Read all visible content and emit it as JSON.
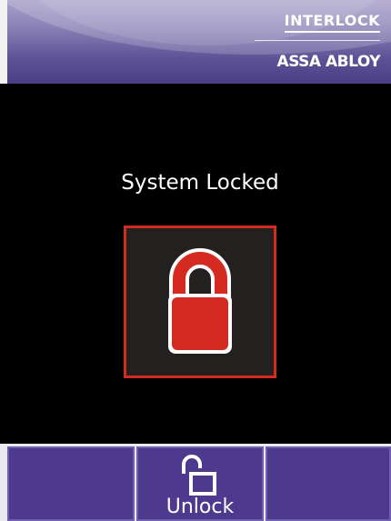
{
  "header": {
    "brand_primary": "INTERLOCK",
    "brand_secondary": "ASSA ABLOY"
  },
  "main": {
    "status_text": "System Locked",
    "status_icon": "padlock-closed-icon",
    "status_color": "#d42a20"
  },
  "bottom_bar": {
    "buttons": [
      {
        "label": ""
      },
      {
        "label": "Unlock",
        "icon": "padlock-open-icon"
      },
      {
        "label": ""
      }
    ]
  },
  "colors": {
    "header": "#5d5295",
    "button": "#4d3a8e",
    "lock_red": "#d42a20",
    "background": "#000000"
  }
}
